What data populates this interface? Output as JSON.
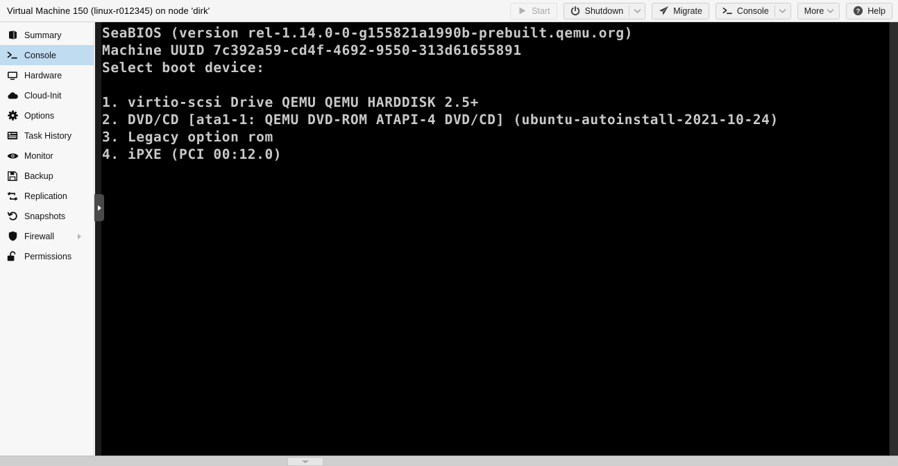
{
  "header": {
    "title": "Virtual Machine 150 (linux-r012345) on node 'dirk'",
    "buttons": [
      {
        "label": "Start",
        "icon": "play-icon",
        "disabled": true,
        "split": false,
        "caret": false
      },
      {
        "label": "Shutdown",
        "icon": "power-icon",
        "disabled": false,
        "split": true,
        "caret": true
      },
      {
        "label": "Migrate",
        "icon": "paper-plane-icon",
        "disabled": false,
        "split": false,
        "caret": false
      },
      {
        "label": "Console",
        "icon": "terminal-icon",
        "disabled": false,
        "split": true,
        "caret": true
      },
      {
        "label": "More",
        "icon": "none",
        "disabled": false,
        "split": false,
        "caret": true
      },
      {
        "label": "Help",
        "icon": "help-circle-icon",
        "disabled": false,
        "split": false,
        "caret": false
      }
    ]
  },
  "sidebar": {
    "items": [
      {
        "label": "Summary",
        "icon": "book-icon",
        "selected": false,
        "expandable": false
      },
      {
        "label": "Console",
        "icon": "terminal-icon",
        "selected": true,
        "expandable": false
      },
      {
        "label": "Hardware",
        "icon": "monitor-icon",
        "selected": false,
        "expandable": false
      },
      {
        "label": "Cloud-Init",
        "icon": "cloud-icon",
        "selected": false,
        "expandable": false
      },
      {
        "label": "Options",
        "icon": "gear-icon",
        "selected": false,
        "expandable": false
      },
      {
        "label": "Task History",
        "icon": "list-icon",
        "selected": false,
        "expandable": false
      },
      {
        "label": "Monitor",
        "icon": "eye-icon",
        "selected": false,
        "expandable": false
      },
      {
        "label": "Backup",
        "icon": "floppy-disk-icon",
        "selected": false,
        "expandable": false
      },
      {
        "label": "Replication",
        "icon": "sync-arrows-icon",
        "selected": false,
        "expandable": false
      },
      {
        "label": "Snapshots",
        "icon": "history-icon",
        "selected": false,
        "expandable": false
      },
      {
        "label": "Firewall",
        "icon": "shield-icon",
        "selected": false,
        "expandable": true
      },
      {
        "label": "Permissions",
        "icon": "unlock-icon",
        "selected": false,
        "expandable": false
      }
    ]
  },
  "console": {
    "lines": [
      "SeaBIOS (version rel-1.14.0-0-g155821a1990b-prebuilt.qemu.org)",
      "Machine UUID 7c392a59-cd4f-4692-9550-313d61655891",
      "Select boot device:",
      "",
      "1. virtio-scsi Drive QEMU QEMU HARDDISK 2.5+",
      "2. DVD/CD [ata1-1: QEMU DVD-ROM ATAPI-4 DVD/CD] (ubuntu-autoinstall-2021-10-24)",
      "3. Legacy option rom",
      "4. iPXE (PCI 00:12.0)"
    ]
  },
  "colors": {
    "header_bg": "#f5f5f5",
    "sidebar_bg": "#f7f7f7",
    "selected_bg": "#bfdcf0",
    "console_bg": "#000000",
    "console_fg": "#c9c9c9",
    "scrollbar_track": "#cfcfcf"
  }
}
